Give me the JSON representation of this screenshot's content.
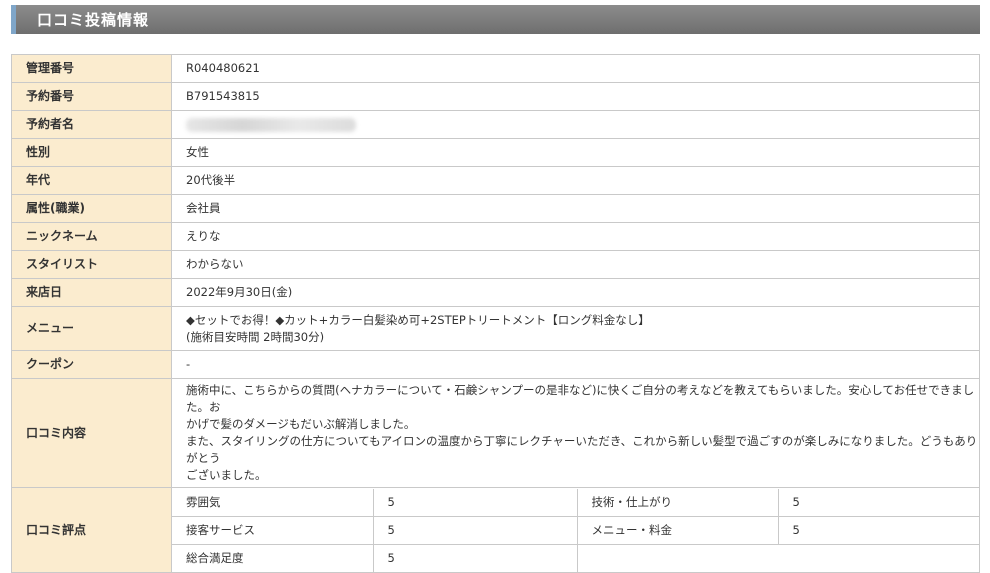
{
  "page_title": "口コミ投稿情報",
  "rows": {
    "management_no": {
      "label": "管理番号",
      "value": "R040480621"
    },
    "reservation_no": {
      "label": "予約番号",
      "value": "B791543815"
    },
    "reserver_name": {
      "label": "予約者名",
      "value": ""
    },
    "gender": {
      "label": "性別",
      "value": "女性"
    },
    "age": {
      "label": "年代",
      "value": "20代後半"
    },
    "occupation": {
      "label": "属性(職業)",
      "value": "会社員"
    },
    "nickname": {
      "label": "ニックネーム",
      "value": "えりな"
    },
    "stylist": {
      "label": "スタイリスト",
      "value": "わからない"
    },
    "visit_date": {
      "label": "来店日",
      "value": "2022年9月30日(金)"
    },
    "menu": {
      "label": "メニュー",
      "line1": "◆セットでお得！◆カット+カラー白髪染め可+2STEPトリートメント【ロング料金なし】",
      "line2": "(施術目安時間 2時間30分)"
    },
    "coupon": {
      "label": "クーポン",
      "value": "-"
    },
    "review": {
      "label": "口コミ内容",
      "line1": "施術中に、こちらからの質問(ヘナカラーについて・石鹸シャンプーの是非など)に快くご自分の考えなどを教えてもらいました。安心してお任せできました。お",
      "line2": "かげで髪のダメージもだいぶ解消しました。",
      "line3": "また、スタイリングの仕方についてもアイロンの温度から丁寧にレクチャーいただき、これから新しい髪型で過ごすのが楽しみになりました。どうもありがとう",
      "line4": "ございました。"
    },
    "rating": {
      "label": "口コミ評点",
      "atmosphere": {
        "label": "雰囲気",
        "value": "5"
      },
      "technique": {
        "label": "技術・仕上がり",
        "value": "5"
      },
      "service": {
        "label": "接客サービス",
        "value": "5"
      },
      "menu_price": {
        "label": "メニュー・料金",
        "value": "5"
      },
      "overall": {
        "label": "総合満足度",
        "value": "5"
      }
    }
  }
}
